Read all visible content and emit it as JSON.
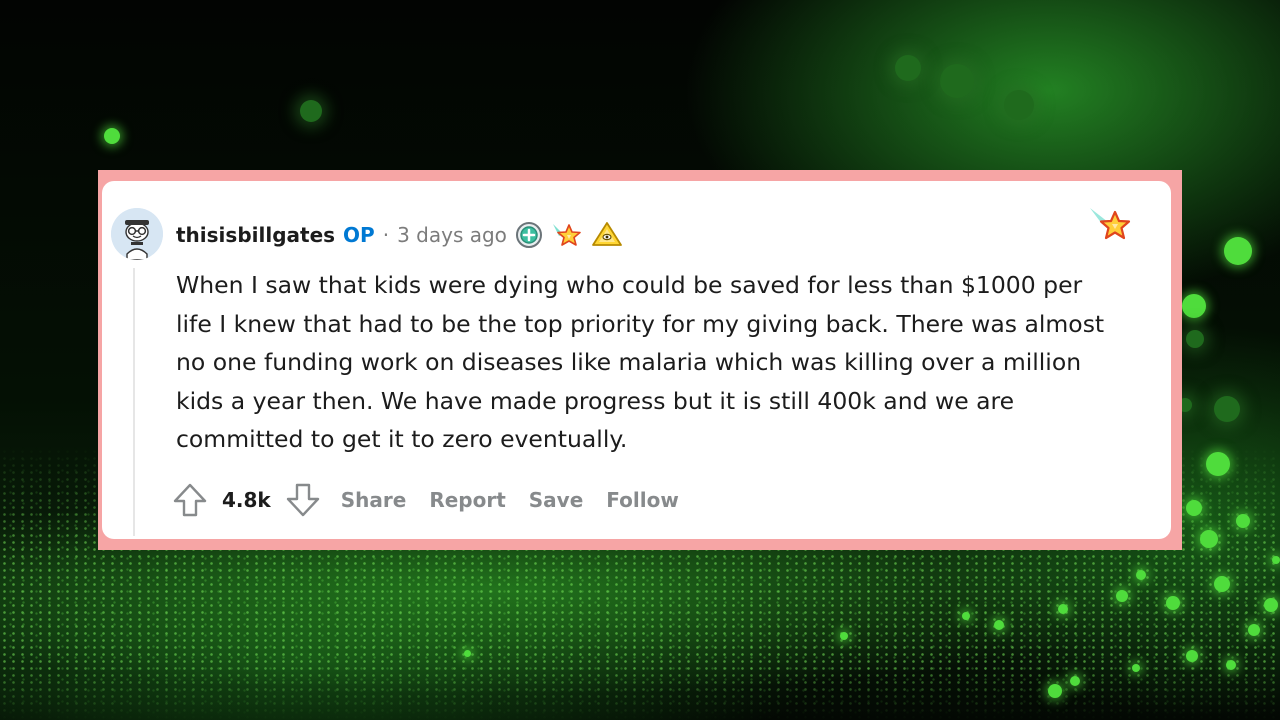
{
  "comment": {
    "author": "thisisbillgates",
    "op_badge": "OP",
    "separator": "·",
    "timestamp": "3 days ago",
    "body": "When I saw that kids were dying who could be saved for less than $1000 per\nlife I knew that had to be the top priority for my giving back. There was almost\nno one funding work on diseases like malaria which was killing over a million\nkids a year then. We have made progress but it is still 400k and we are\ncommitted to get it to zero eventually.",
    "score": "4.8k",
    "actions": {
      "share": "Share",
      "report": "Report",
      "save": "Save",
      "follow": "Follow"
    },
    "awards": [
      "helpful-award-icon",
      "shooting-star-award-icon",
      "wholesome-award-icon"
    ],
    "corner_award": "rising-star-award-icon"
  },
  "colors": {
    "frame": "#f6a5a5",
    "op_blue": "#0079d3",
    "action_gray": "#878a8c",
    "text": "#1c1c1c"
  }
}
